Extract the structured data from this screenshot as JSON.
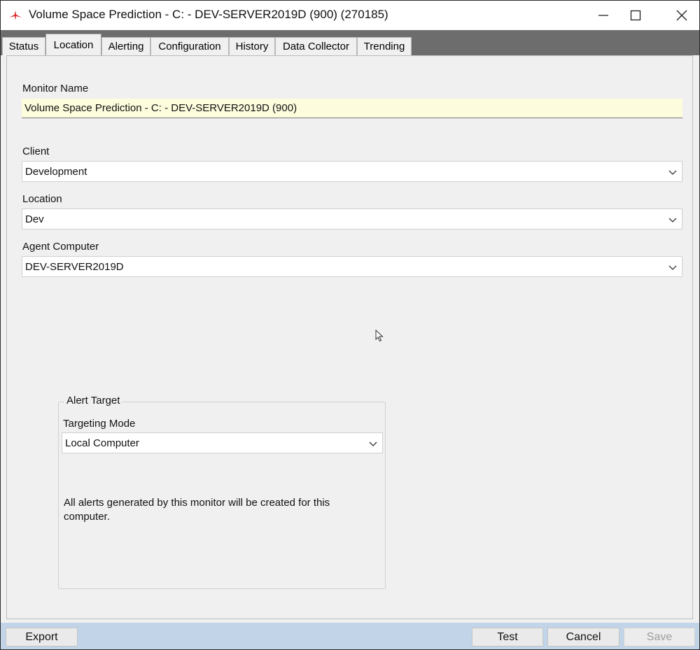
{
  "window": {
    "title": "Volume Space Prediction - C: - DEV-SERVER2019D (900) (270185)",
    "controls": {
      "minimize_icon": "minimize-icon",
      "maximize_icon": "maximize-icon",
      "close_icon": "close-icon"
    },
    "accent_color": "#d9252a"
  },
  "tabs": [
    {
      "label": "Status",
      "active": false
    },
    {
      "label": "Location",
      "active": true
    },
    {
      "label": "Alerting",
      "active": false
    },
    {
      "label": "Configuration",
      "active": false
    },
    {
      "label": "History",
      "active": false
    },
    {
      "label": "Data Collector",
      "active": false
    },
    {
      "label": "Trending",
      "active": false
    }
  ],
  "form": {
    "monitor_name": {
      "label": "Monitor Name",
      "value": "Volume Space Prediction - C: - DEV-SERVER2019D (900)"
    },
    "client": {
      "label": "Client",
      "value": "Development"
    },
    "location": {
      "label": "Location",
      "value": "Dev"
    },
    "agent_computer": {
      "label": "Agent Computer",
      "value": "DEV-SERVER2019D"
    }
  },
  "alert_target": {
    "group_title": "Alert Target",
    "targeting_mode_label": "Targeting Mode",
    "targeting_mode_value": "Local Computer",
    "description": "All alerts generated by this monitor will be created for this computer."
  },
  "footer": {
    "export": "Export",
    "test": "Test",
    "cancel": "Cancel",
    "save": "Save",
    "save_enabled": false
  }
}
